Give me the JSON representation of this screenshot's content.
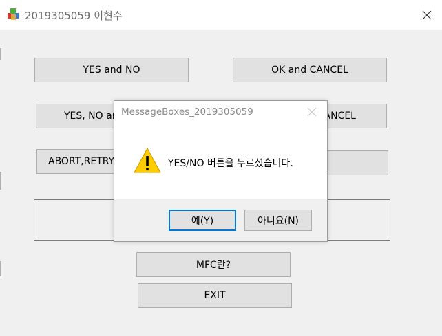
{
  "window": {
    "title": "2019305059 이현수",
    "close_icon": "close-icon"
  },
  "buttons": {
    "yes_no": "YES and NO",
    "ok_cancel": "OK and CANCEL",
    "yes_no_cancel_partial": "YES, NO an",
    "cancel_partial": "ANCEL",
    "abort_retry_partial": "ABORT,RETRY",
    "mfc": "MFC란?",
    "exit": "EXIT"
  },
  "dialog": {
    "title": "MessageBoxes_2019305059",
    "icon": "warning-icon",
    "message": "YES/NO 버튼을 누르셨습니다.",
    "yes_label": "예(Y)",
    "no_label": "아니요(N)"
  },
  "colors": {
    "background": "#f0f0f0",
    "button_face": "#e1e1e1",
    "warning_yellow": "#ffcc00",
    "focus_border": "#0078d7"
  }
}
